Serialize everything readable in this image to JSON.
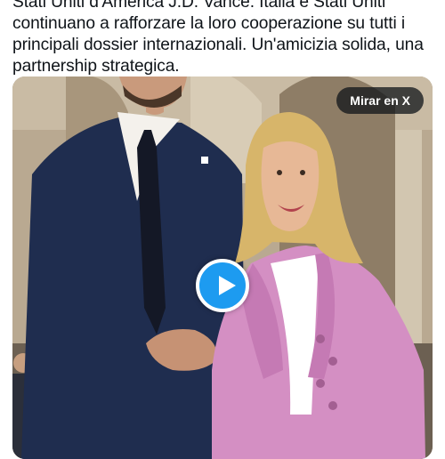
{
  "tweet": {
    "text_lines": [
      "Stati Uniti d'America J.D. Vance. Italia e Stati Uniti",
      "continuano a rafforzare la loro cooperazione su tutti i",
      "principali dossier internazionali. Un'amicizia solida, una",
      "partnership strategica."
    ]
  },
  "media": {
    "view_on_x_label": "Mirar en X",
    "play_icon": "play-icon",
    "accent_color": "#1d9bf0"
  }
}
